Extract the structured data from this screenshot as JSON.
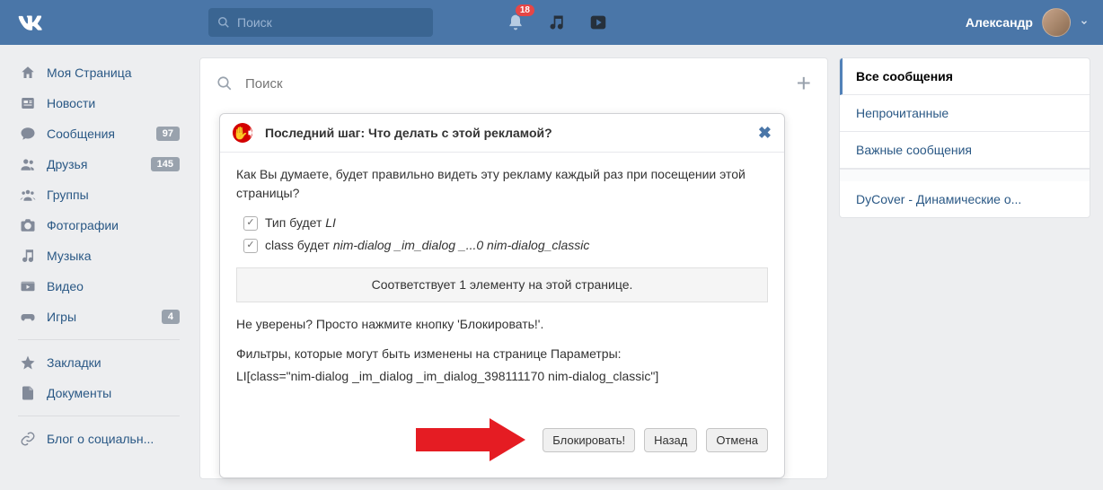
{
  "topbar": {
    "search_placeholder": "Поиск",
    "notifications_count": "18",
    "user_name": "Александр"
  },
  "sidebar": {
    "items": [
      {
        "label": "Моя Страница",
        "icon": "home"
      },
      {
        "label": "Новости",
        "icon": "news"
      },
      {
        "label": "Сообщения",
        "icon": "messages",
        "badge": "97"
      },
      {
        "label": "Друзья",
        "icon": "friends",
        "badge": "145"
      },
      {
        "label": "Группы",
        "icon": "groups"
      },
      {
        "label": "Фотографии",
        "icon": "photos"
      },
      {
        "label": "Музыка",
        "icon": "music"
      },
      {
        "label": "Видео",
        "icon": "video"
      },
      {
        "label": "Игры",
        "icon": "games",
        "badge": "4"
      }
    ],
    "items2": [
      {
        "label": "Закладки",
        "icon": "bookmarks"
      },
      {
        "label": "Документы",
        "icon": "docs"
      }
    ],
    "items3": [
      {
        "label": "Блог о социальн...",
        "icon": "blog"
      }
    ]
  },
  "main_search_placeholder": "Поиск",
  "right_tabs": {
    "items": [
      "Все сообщения",
      "Непрочитанные",
      "Важные сообщения"
    ],
    "extra": "DyCover - Динамические о..."
  },
  "dialog": {
    "title": "Последний шаг: Что делать с этой рекламой?",
    "question": "Как Вы думаете, будет правильно видеть эту рекламу каждый раз при посещении этой страницы?",
    "check1_prefix": "Тип будет ",
    "check1_value": "LI",
    "check2_prefix": "class будет ",
    "check2_value": "nim-dialog _im_dialog _...0 nim-dialog_classic",
    "match_text": "Соответствует 1 элементу на этой странице.",
    "unsure_text": "Не уверены? Просто нажмите кнопку 'Блокировать!'.",
    "filters_text_1": "Фильтры, которые могут быть изменены на странице Параметры:",
    "filters_text_2": "LI[class=\"nim-dialog _im_dialog _im_dialog_398111170 nim-dialog_classic\"]",
    "btn_block": "Блокировать!",
    "btn_back": "Назад",
    "btn_cancel": "Отмена"
  }
}
